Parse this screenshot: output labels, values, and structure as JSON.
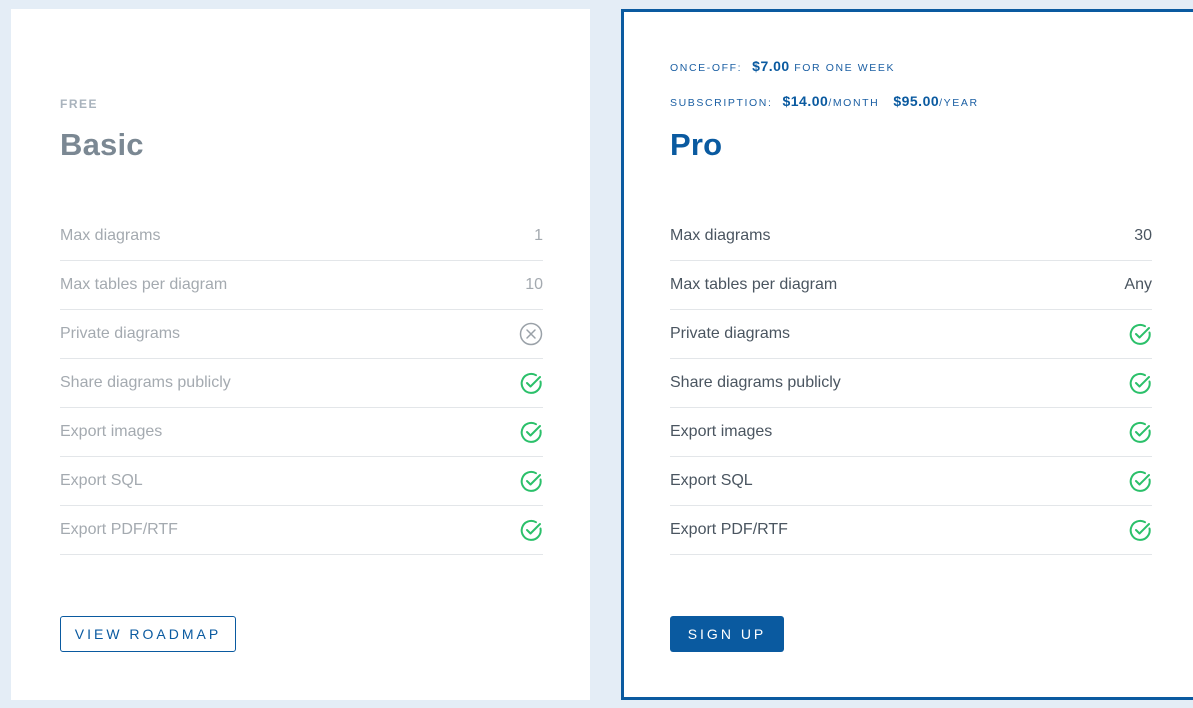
{
  "colors": {
    "background": "#e4edf6",
    "brand": "#0a5aa0",
    "check_green": "#2bc06a",
    "cross_gray": "#9aa1a8"
  },
  "plans": [
    {
      "id": "basic",
      "tier_label": "FREE",
      "title": "Basic",
      "features": [
        {
          "label": "Max diagrams",
          "value": "1",
          "type": "text"
        },
        {
          "label": "Max tables per diagram",
          "value": "10",
          "type": "text"
        },
        {
          "label": "Private diagrams",
          "value": "x-circle-icon",
          "type": "icon"
        },
        {
          "label": "Share diagrams publicly",
          "value": "check-circle-icon",
          "type": "icon"
        },
        {
          "label": "Export images",
          "value": "check-circle-icon",
          "type": "icon"
        },
        {
          "label": "Export SQL",
          "value": "check-circle-icon",
          "type": "icon"
        },
        {
          "label": "Export PDF/RTF",
          "value": "check-circle-icon",
          "type": "icon"
        }
      ],
      "button_label": "VIEW ROADMAP"
    },
    {
      "id": "pro",
      "pricing": {
        "once_off_label": "ONCE-OFF:",
        "once_off_amount": "$7.00",
        "once_off_suffix": "FOR ONE WEEK",
        "subscription_label": "SUBSCRIPTION:",
        "monthly_amount": "$14.00",
        "monthly_suffix": "/MONTH",
        "yearly_amount": "$95.00",
        "yearly_suffix": "/YEAR"
      },
      "title": "Pro",
      "features": [
        {
          "label": "Max diagrams",
          "value": "30",
          "type": "text"
        },
        {
          "label": "Max tables per diagram",
          "value": "Any",
          "type": "text"
        },
        {
          "label": "Private diagrams",
          "value": "check-circle-icon",
          "type": "icon"
        },
        {
          "label": "Share diagrams publicly",
          "value": "check-circle-icon",
          "type": "icon"
        },
        {
          "label": "Export images",
          "value": "check-circle-icon",
          "type": "icon"
        },
        {
          "label": "Export SQL",
          "value": "check-circle-icon",
          "type": "icon"
        },
        {
          "label": "Export PDF/RTF",
          "value": "check-circle-icon",
          "type": "icon"
        }
      ],
      "button_label": "SIGN UP"
    }
  ]
}
